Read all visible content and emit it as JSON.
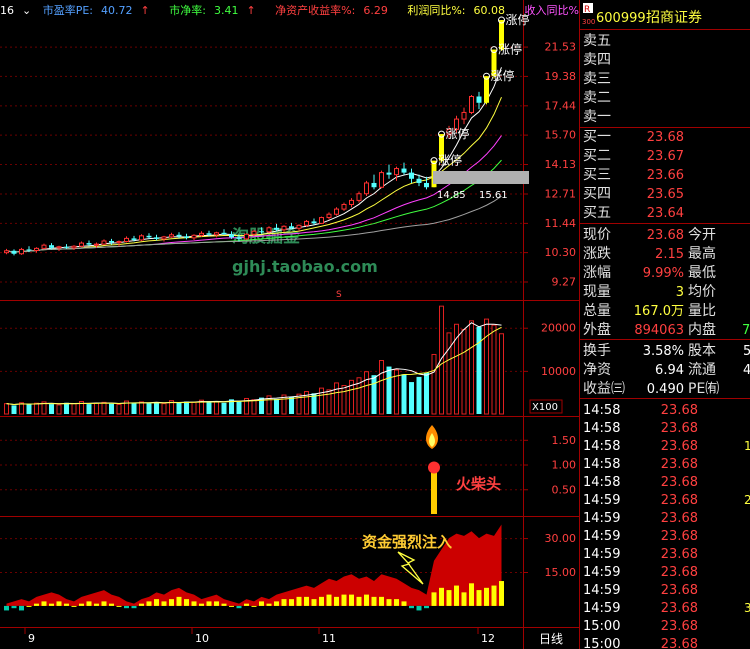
{
  "header": {
    "period": "16",
    "pe_label": "市盈率PE:",
    "pe_value": "40.72",
    "pb_label": "市净率:",
    "pb_value": "3.41",
    "roe_label": "净资产收益率%:",
    "roe_value": "6.29",
    "profit_label": "利润同比%:",
    "profit_value": "60.08",
    "rev_label": "收入同比%:"
  },
  "stock": {
    "code": "600999",
    "name": "招商证券",
    "tag_r": "R",
    "tag_index": "300"
  },
  "overlays": {
    "watermark_cn": "淘股掘金",
    "watermark_url": "gjhj.taobao.com",
    "limit_up_label": "涨停",
    "price_box_low": "14.85",
    "price_box_high": "15.61",
    "fire_text": "火柴头",
    "inflow_text": "资金强烈注入",
    "vol_unit": "X100",
    "period_button": "日线",
    "marker_s": "S"
  },
  "chart_data": [
    {
      "type": "candlestick",
      "title": "",
      "x_labels": [
        "9",
        "10",
        "11",
        "12"
      ],
      "y_ticks": [
        21.53,
        19.38,
        17.44,
        15.7,
        14.13,
        12.71,
        11.44,
        10.3,
        9.27
      ],
      "ylim": [
        8.8,
        24.2
      ],
      "log_scale": true,
      "candles": [
        [
          10.28,
          10.42,
          10.22,
          10.35
        ],
        [
          10.35,
          10.4,
          10.18,
          10.24
        ],
        [
          10.24,
          10.46,
          10.2,
          10.4
        ],
        [
          10.4,
          10.52,
          10.3,
          10.36
        ],
        [
          10.36,
          10.48,
          10.28,
          10.44
        ],
        [
          10.44,
          10.62,
          10.4,
          10.56
        ],
        [
          10.56,
          10.64,
          10.4,
          10.46
        ],
        [
          10.46,
          10.54,
          10.34,
          10.5
        ],
        [
          10.5,
          10.6,
          10.42,
          10.46
        ],
        [
          10.46,
          10.56,
          10.38,
          10.52
        ],
        [
          10.52,
          10.7,
          10.48,
          10.64
        ],
        [
          10.64,
          10.74,
          10.52,
          10.58
        ],
        [
          10.58,
          10.66,
          10.46,
          10.6
        ],
        [
          10.6,
          10.78,
          10.56,
          10.72
        ],
        [
          10.72,
          10.8,
          10.58,
          10.66
        ],
        [
          10.66,
          10.74,
          10.52,
          10.7
        ],
        [
          10.7,
          10.9,
          10.66,
          10.82
        ],
        [
          10.82,
          10.92,
          10.7,
          10.76
        ],
        [
          10.76,
          10.98,
          10.72,
          10.92
        ],
        [
          10.92,
          11.02,
          10.8,
          10.86
        ],
        [
          10.86,
          10.96,
          10.74,
          10.8
        ],
        [
          10.8,
          10.92,
          10.7,
          10.88
        ],
        [
          10.88,
          11.04,
          10.84,
          10.96
        ],
        [
          10.96,
          11.06,
          10.82,
          10.9
        ],
        [
          10.9,
          11.0,
          10.78,
          10.84
        ],
        [
          10.84,
          10.98,
          10.76,
          10.94
        ],
        [
          10.94,
          11.1,
          10.88,
          11.02
        ],
        [
          11.02,
          11.12,
          10.9,
          10.96
        ],
        [
          10.96,
          11.08,
          10.86,
          11.04
        ],
        [
          11.04,
          11.18,
          10.96,
          10.98
        ],
        [
          10.98,
          11.1,
          10.8,
          10.86
        ],
        [
          10.86,
          10.98,
          10.7,
          10.8
        ],
        [
          10.8,
          11.02,
          10.76,
          10.98
        ],
        [
          10.98,
          11.16,
          10.92,
          11.1
        ],
        [
          11.1,
          11.26,
          11.0,
          11.08
        ],
        [
          11.08,
          11.3,
          11.02,
          11.24
        ],
        [
          11.24,
          11.4,
          11.1,
          11.16
        ],
        [
          11.16,
          11.34,
          11.08,
          11.3
        ],
        [
          11.3,
          11.44,
          11.18,
          11.22
        ],
        [
          11.22,
          11.38,
          11.12,
          11.34
        ],
        [
          11.34,
          11.56,
          11.28,
          11.5
        ],
        [
          11.5,
          11.62,
          11.36,
          11.42
        ],
        [
          11.42,
          11.7,
          11.4,
          11.66
        ],
        [
          11.66,
          11.88,
          11.58,
          11.8
        ],
        [
          11.8,
          12.1,
          11.74,
          12.02
        ],
        [
          12.02,
          12.3,
          11.94,
          12.22
        ],
        [
          12.22,
          12.5,
          12.1,
          12.4
        ],
        [
          12.4,
          12.8,
          12.3,
          12.7
        ],
        [
          12.7,
          13.3,
          12.6,
          13.2
        ],
        [
          13.2,
          13.6,
          12.9,
          13.0
        ],
        [
          13.0,
          13.8,
          12.95,
          13.7
        ],
        [
          13.7,
          14.1,
          13.4,
          13.6
        ],
        [
          13.6,
          14.0,
          13.3,
          13.9
        ],
        [
          13.9,
          14.2,
          13.6,
          13.7
        ],
        [
          13.7,
          13.9,
          13.2,
          13.4
        ],
        [
          13.4,
          13.6,
          13.05,
          13.2
        ],
        [
          13.2,
          13.5,
          12.9,
          13.0
        ],
        [
          13.0,
          14.3,
          13.0,
          14.3
        ],
        [
          14.3,
          15.73,
          14.2,
          15.73
        ],
        [
          15.73,
          16.2,
          15.5,
          16.0
        ],
        [
          16.0,
          16.8,
          15.8,
          16.6
        ],
        [
          16.6,
          17.3,
          16.3,
          17.0
        ],
        [
          17.0,
          18.1,
          16.9,
          18.0
        ],
        [
          18.0,
          18.3,
          17.2,
          17.6
        ],
        [
          17.6,
          19.36,
          17.5,
          19.36
        ],
        [
          19.36,
          21.3,
          19.2,
          21.3
        ],
        [
          21.3,
          23.68,
          21.2,
          23.68
        ]
      ],
      "limit_up_days": [
        57,
        58,
        64,
        65,
        66
      ]
    },
    {
      "type": "bar",
      "title": "",
      "y_ticks": [
        20000,
        10000
      ],
      "ylim": [
        0,
        25500
      ],
      "values": [
        2400,
        2000,
        2600,
        2200,
        2500,
        2800,
        2300,
        2100,
        2600,
        2400,
        2900,
        2300,
        2500,
        2700,
        2400,
        2200,
        3000,
        2600,
        2800,
        2500,
        2700,
        2400,
        3100,
        2600,
        2900,
        2700,
        3200,
        3000,
        2800,
        2600,
        3400,
        3100,
        3600,
        3300,
        3800,
        4200,
        3500,
        4400,
        4000,
        4600,
        5200,
        4800,
        6000,
        5600,
        7200,
        6600,
        7800,
        8400,
        9800,
        9000,
        12400,
        11000,
        10200,
        9200,
        7400,
        8600,
        9600,
        13800,
        25000,
        18800,
        20800,
        19600,
        21600,
        20200,
        22000,
        20600,
        18600
      ],
      "up_days_color": "#e02020",
      "down_days_color": "#54ffff"
    },
    {
      "type": "bar",
      "title": "",
      "y_ticks": [
        1.5,
        1.0,
        0.5
      ],
      "ylim": [
        0,
        1.9
      ],
      "signal_day": 57,
      "signal_value": 0.9
    },
    {
      "type": "area",
      "title": "",
      "y_ticks": [
        30.0,
        15.0
      ],
      "ylim": [
        -8,
        38
      ],
      "area_values": [
        1,
        2,
        3,
        2,
        4,
        5,
        6,
        5,
        3,
        2,
        4,
        5,
        6,
        7,
        5,
        4,
        2,
        1,
        3,
        4,
        6,
        5,
        7,
        8,
        6,
        5,
        3,
        4,
        5,
        3,
        2,
        1,
        3,
        2,
        4,
        3,
        5,
        6,
        7,
        8,
        9,
        8,
        10,
        12,
        11,
        13,
        14,
        12,
        13,
        11,
        14,
        13,
        12,
        10,
        8,
        7,
        5,
        20,
        25,
        30,
        32,
        31,
        33,
        30,
        32,
        31,
        36
      ],
      "bar_values": [
        -2,
        -1,
        -2,
        0,
        1,
        2,
        1,
        2,
        1,
        0,
        1,
        2,
        1,
        2,
        1,
        0,
        -1,
        -1,
        1,
        2,
        3,
        2,
        3,
        4,
        3,
        2,
        1,
        2,
        2,
        1,
        0,
        -1,
        1,
        0,
        2,
        1,
        2,
        3,
        3,
        4,
        4,
        3,
        4,
        5,
        4,
        5,
        5,
        4,
        5,
        4,
        4,
        3,
        3,
        2,
        -1,
        -2,
        -1,
        6,
        8,
        7,
        9,
        6,
        10,
        7,
        8,
        9,
        11
      ]
    }
  ],
  "quote": {
    "asks": [
      {
        "label": "卖五"
      },
      {
        "label": "卖四"
      },
      {
        "label": "卖三"
      },
      {
        "label": "卖二"
      },
      {
        "label": "卖一"
      }
    ],
    "bids": [
      {
        "label": "买一",
        "value": "23.68"
      },
      {
        "label": "买二",
        "value": "23.67"
      },
      {
        "label": "买三",
        "value": "23.66"
      },
      {
        "label": "买四",
        "value": "23.65"
      },
      {
        "label": "买五",
        "value": "23.64"
      }
    ],
    "stats": [
      {
        "l1": "现价",
        "v1": "23.68",
        "l2": "今开",
        "c": "#ff4040"
      },
      {
        "l1": "涨跌",
        "v1": "2.15",
        "l2": "最高",
        "c": "#ff4040"
      },
      {
        "l1": "涨幅",
        "v1": "9.99%",
        "l2": "最低",
        "c": "#ff4040"
      },
      {
        "l1": "现量",
        "v1": "3",
        "l2": "均价",
        "c": "#ffff40"
      },
      {
        "l1": "总量",
        "v1": "167.0万",
        "l2": "量比",
        "c": "#ffff40"
      },
      {
        "l1": "外盘",
        "v1": "894063",
        "l2": "内盘",
        "c": "#ff4040",
        "tail": "7",
        "tail_c": "#40ff40"
      }
    ],
    "info": [
      {
        "l1": "换手",
        "v1": "3.58%",
        "l2": "股本",
        "tail": "5"
      },
      {
        "l1": "净资",
        "v1": "6.94",
        "l2": "流通",
        "tail": "4"
      },
      {
        "l1": "收益㈢",
        "v1": "0.490",
        "l2": "PE㈲",
        "tail": ""
      }
    ],
    "ticks": [
      {
        "time": "14:58",
        "price": "23.68",
        "tail": ""
      },
      {
        "time": "14:58",
        "price": "23.68",
        "tail": ""
      },
      {
        "time": "14:58",
        "price": "23.68",
        "tail": "1"
      },
      {
        "time": "14:58",
        "price": "23.68",
        "tail": ""
      },
      {
        "time": "14:58",
        "price": "23.68",
        "tail": ""
      },
      {
        "time": "14:59",
        "price": "23.68",
        "tail": "2"
      },
      {
        "time": "14:59",
        "price": "23.68",
        "tail": ""
      },
      {
        "time": "14:59",
        "price": "23.68",
        "tail": ""
      },
      {
        "time": "14:59",
        "price": "23.68",
        "tail": ""
      },
      {
        "time": "14:59",
        "price": "23.68",
        "tail": ""
      },
      {
        "time": "14:59",
        "price": "23.68",
        "tail": ""
      },
      {
        "time": "14:59",
        "price": "23.68",
        "tail": "3"
      },
      {
        "time": "15:00",
        "price": "23.68",
        "tail": ""
      },
      {
        "time": "15:00",
        "price": "23.68",
        "tail": ""
      }
    ]
  }
}
